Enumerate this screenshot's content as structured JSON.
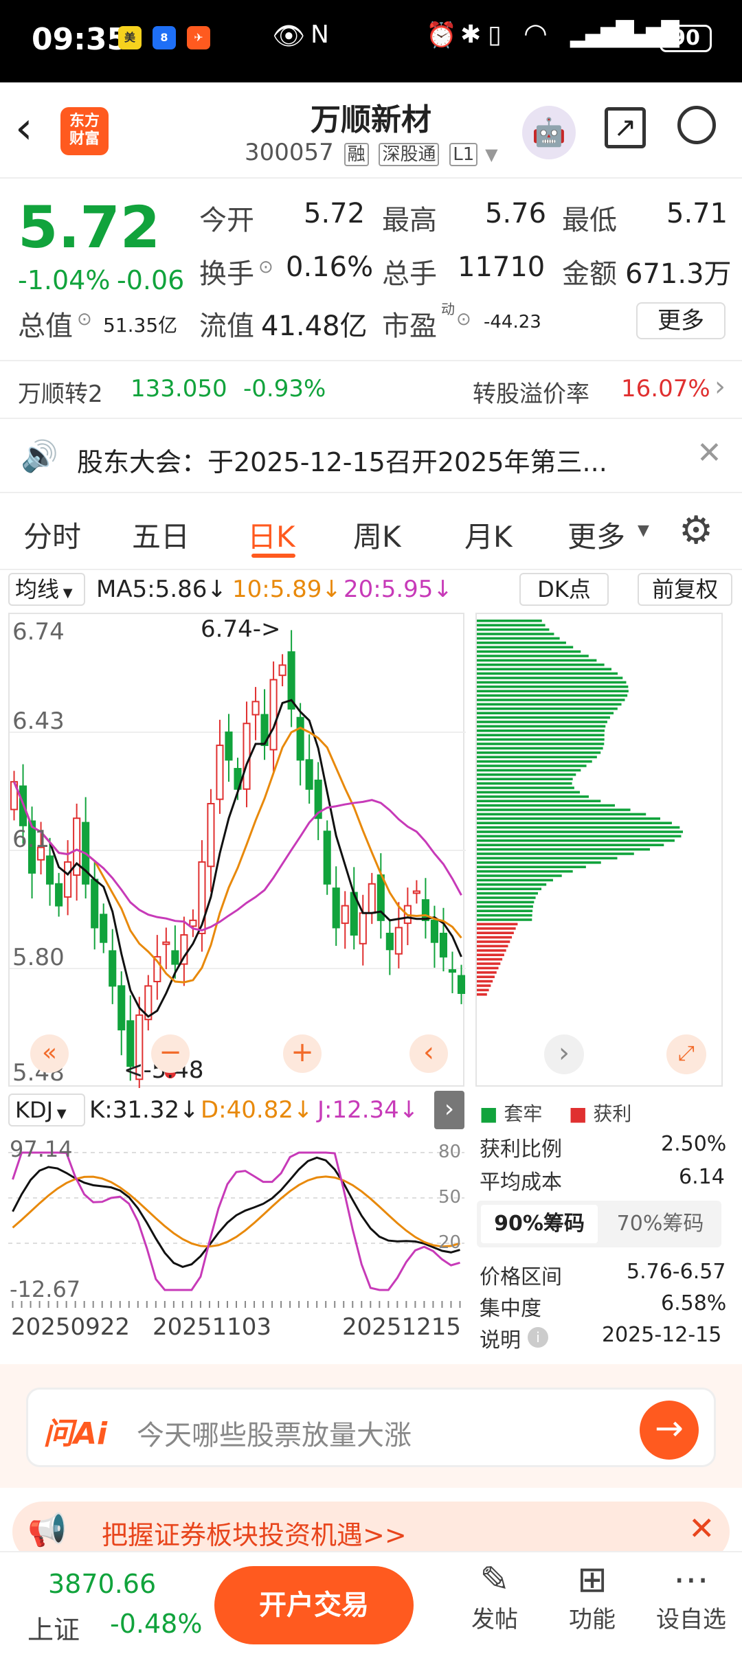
{
  "status": {
    "time": "09:35",
    "battery": "90"
  },
  "header": {
    "title": "万顺新材",
    "code": "300057",
    "tags": [
      "融",
      "深股通",
      "L1"
    ],
    "logo_text": "东方\n财富"
  },
  "quote": {
    "price": "5.72",
    "change_pct": "-1.04%",
    "change": "-0.06",
    "open_label": "今开",
    "open": "5.72",
    "high_label": "最高",
    "high": "5.76",
    "low_label": "最低",
    "low": "5.71",
    "turnover_label": "换手",
    "turnover": "0.16%",
    "volume_label": "总手",
    "volume": "11710",
    "amount_label": "金额",
    "amount": "671.3万",
    "mktcap_label": "总值",
    "mktcap": "51.35亿",
    "float_label": "流值",
    "float": "41.48亿",
    "pe_label": "市盈",
    "pe_sup": "动",
    "pe": "-44.23",
    "more_label": "更多"
  },
  "bond": {
    "name": "万顺转2",
    "price": "133.050",
    "change": "-0.93%",
    "premium_label": "转股溢价率",
    "premium": "16.07%"
  },
  "notice": {
    "text": "股东大会：于2025-12-15召开2025年第三..."
  },
  "tabs": [
    "分时",
    "五日",
    "日K",
    "周K",
    "月K",
    "更多"
  ],
  "active_tab": "日K",
  "ma": {
    "selector": "均线",
    "ma5": "MA5:5.86",
    "ma10": "10:5.89",
    "ma20": "20:5.95",
    "dk": "DK点",
    "adj": "前复权"
  },
  "kline": {
    "y_ticks": [
      "6.74",
      "6.43",
      "6.1",
      "5.80",
      "5.48"
    ],
    "high_mark": "6.74->",
    "low_mark": "<-5.48"
  },
  "kdj": {
    "selector": "KDJ",
    "k": "K:31.32",
    "d": "D:40.82",
    "j": "J:12.34",
    "y_top": "97.14",
    "y_bottom": "-12.67",
    "levels": [
      "80",
      "50",
      "20"
    ],
    "dates": [
      "20250922",
      "20251103",
      "20251215"
    ]
  },
  "chips": {
    "legend_hold": "套牢",
    "legend_profit": "获利",
    "profit_ratio_label": "获利比例",
    "profit_ratio": "2.50%",
    "avg_cost_label": "平均成本",
    "avg_cost": "6.14",
    "tab90": "90%筹码",
    "tab70": "70%筹码",
    "range_label": "价格区间",
    "range": "5.76-6.57",
    "conc_label": "集中度",
    "conc": "6.58%",
    "note_label": "说明",
    "note_date": "2025-12-15"
  },
  "ai": {
    "brand": "问Ai",
    "placeholder": "今天哪些股票放量大涨"
  },
  "banner": {
    "text": "把握证券板块投资机遇>>"
  },
  "bottom": {
    "index_value": "3870.66",
    "index_name": "上证",
    "index_change": "-0.48%",
    "trade_label": "开户交易",
    "post": "发帖",
    "func": "功能",
    "watch": "设自选"
  },
  "colors": {
    "up": "#e03030",
    "down": "#11a33c",
    "accent": "#ff6a1a",
    "ma10": "#e8890b",
    "ma20": "#c73ab8"
  }
}
